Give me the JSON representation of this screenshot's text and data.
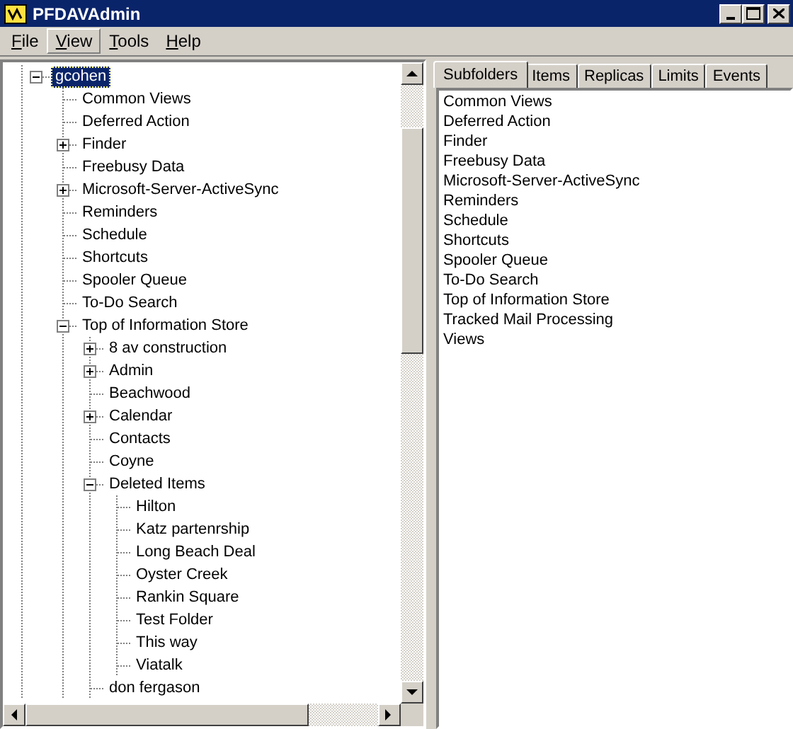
{
  "window": {
    "title": "PFDAVAdmin"
  },
  "menu": [
    {
      "label": "File",
      "selected": false
    },
    {
      "label": "View",
      "selected": true
    },
    {
      "label": "Tools",
      "selected": false
    },
    {
      "label": "Help",
      "selected": false
    }
  ],
  "tree": [
    {
      "label": "gcohen",
      "selected": true,
      "expanded": true,
      "children": [
        {
          "label": "Common Views"
        },
        {
          "label": "Deferred Action"
        },
        {
          "label": "Finder",
          "expanded": false
        },
        {
          "label": "Freebusy Data"
        },
        {
          "label": "Microsoft-Server-ActiveSync",
          "expanded": false
        },
        {
          "label": "Reminders"
        },
        {
          "label": "Schedule"
        },
        {
          "label": "Shortcuts"
        },
        {
          "label": "Spooler Queue"
        },
        {
          "label": "To-Do Search"
        },
        {
          "label": "Top of Information Store",
          "expanded": true,
          "children": [
            {
              "label": "8 av construction",
              "expanded": false
            },
            {
              "label": "Admin",
              "expanded": false
            },
            {
              "label": "Beachwood"
            },
            {
              "label": "Calendar",
              "expanded": false
            },
            {
              "label": "Contacts"
            },
            {
              "label": "Coyne"
            },
            {
              "label": "Deleted Items",
              "expanded": true,
              "children": [
                {
                  "label": "Hilton"
                },
                {
                  "label": "Katz partenrship"
                },
                {
                  "label": "Long Beach Deal"
                },
                {
                  "label": "Oyster Creek"
                },
                {
                  "label": "Rankin Square"
                },
                {
                  "label": "Test Folder"
                },
                {
                  "label": "This way"
                },
                {
                  "label": "Viatalk"
                }
              ]
            },
            {
              "label": "don fergason"
            }
          ]
        }
      ]
    }
  ],
  "tabs": [
    {
      "label": "Subfolders",
      "selected": true
    },
    {
      "label": "Items",
      "selected": false
    },
    {
      "label": "Replicas",
      "selected": false
    },
    {
      "label": "Limits",
      "selected": false
    },
    {
      "label": "Events",
      "selected": false
    }
  ],
  "subfolders": [
    "Common Views",
    "Deferred Action",
    "Finder",
    "Freebusy Data",
    "Microsoft-Server-ActiveSync",
    "Reminders",
    "Schedule",
    "Shortcuts",
    "Spooler Queue",
    "To-Do Search",
    "Top of Information Store",
    "Tracked Mail Processing",
    "Views"
  ]
}
